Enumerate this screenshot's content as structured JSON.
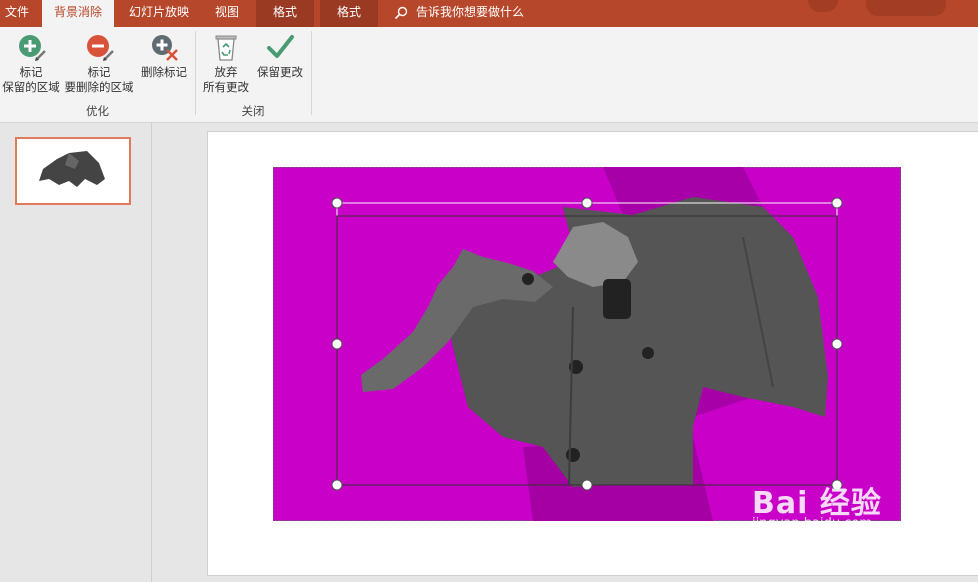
{
  "tabs": [
    {
      "label": "文件"
    },
    {
      "label": "背景消除"
    },
    {
      "label": "幻灯片放映"
    },
    {
      "label": "视图"
    },
    {
      "label": "格式"
    },
    {
      "label": "格式"
    }
  ],
  "tell_me": "告诉我你想要做什么",
  "ribbon": {
    "mark_keep_l1": "标记",
    "mark_keep_l2": "保留的区域",
    "mark_remove_l1": "标记",
    "mark_remove_l2": "要删除的区域",
    "delete_mark": "删除标记",
    "discard_l1": "放弃",
    "discard_l2": "所有更改",
    "keep_changes": "保留更改",
    "group_refine": "优化",
    "group_close": "关闭"
  },
  "watermark": {
    "brand": "Bai 经验",
    "url": "jingyan.baidu.com"
  },
  "colors": {
    "accent": "#b7472a",
    "removal_overlay": "#c800c8"
  },
  "icons": {
    "mark_keep": "plus-circle-pencil-icon",
    "mark_remove": "minus-circle-pencil-icon",
    "delete_mark": "delete-mark-icon",
    "discard": "recycle-bin-icon",
    "keep": "checkmark-icon",
    "search": "search-icon"
  }
}
